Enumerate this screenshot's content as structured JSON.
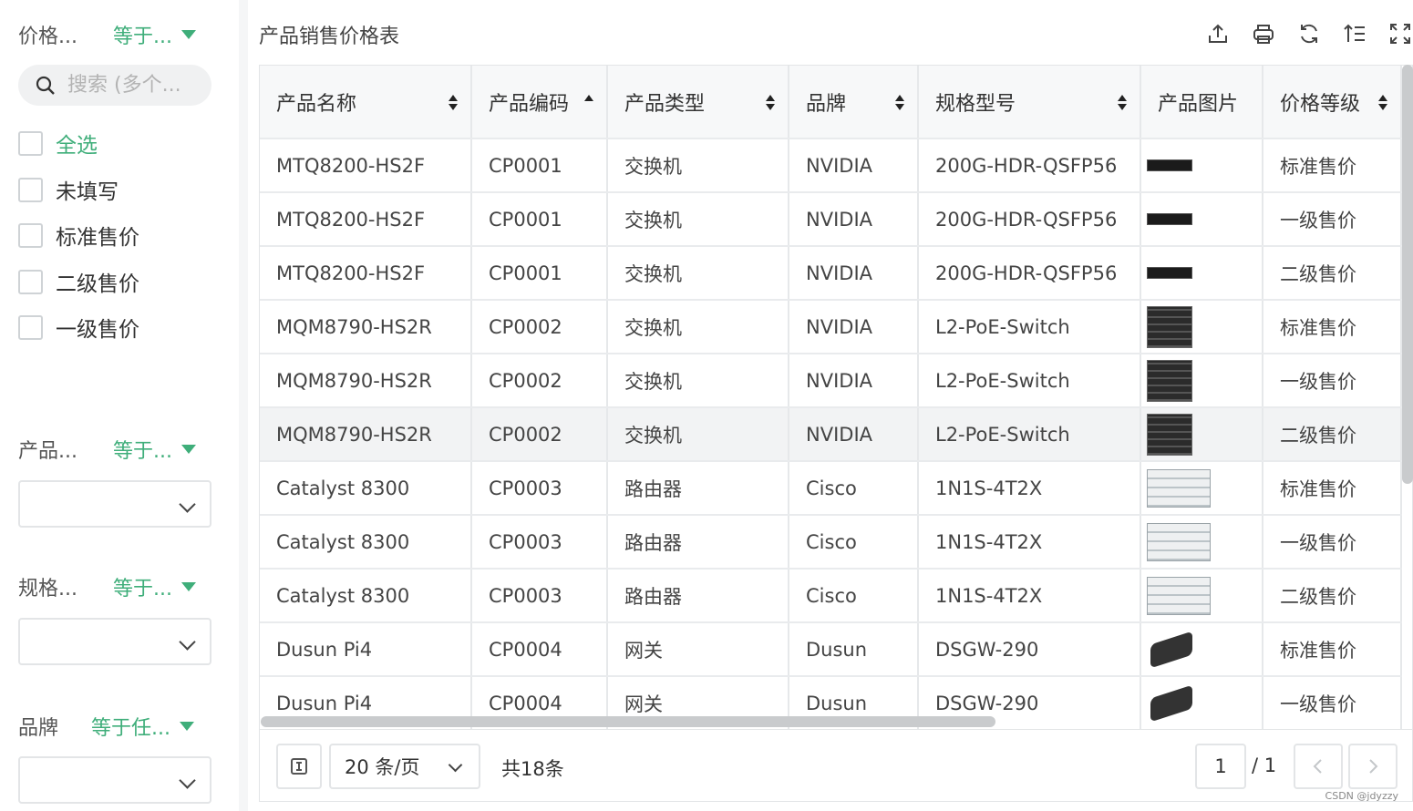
{
  "filters": {
    "price": {
      "name": "价格...",
      "op": "等于..."
    },
    "search": {
      "placeholder": "搜索 (多个..."
    },
    "options": [
      "全选",
      "未填写",
      "标准售价",
      "二级售价",
      "一级售价"
    ],
    "product": {
      "name": "产品...",
      "op": "等于..."
    },
    "spec": {
      "name": "规格...",
      "op": "等于..."
    },
    "brand": {
      "name": "品牌",
      "op": "等于任..."
    }
  },
  "title": "产品销售价格表",
  "toolbar": [
    "upload-icon",
    "print-icon",
    "refresh-icon",
    "sort-list-icon",
    "fullscreen-icon"
  ],
  "columns": [
    "产品名称",
    "产品编码",
    "产品类型",
    "品牌",
    "规格型号",
    "产品图片",
    "价格等级"
  ],
  "rows": [
    [
      "MTQ8200-HS2F",
      "CP0001",
      "交换机",
      "NVIDIA",
      "200G-HDR-QSFP56",
      "sw",
      "标准售价"
    ],
    [
      "MTQ8200-HS2F",
      "CP0001",
      "交换机",
      "NVIDIA",
      "200G-HDR-QSFP56",
      "sw",
      "一级售价"
    ],
    [
      "MTQ8200-HS2F",
      "CP0001",
      "交换机",
      "NVIDIA",
      "200G-HDR-QSFP56",
      "sw",
      "二级售价"
    ],
    [
      "MQM8790-HS2R",
      "CP0002",
      "交换机",
      "NVIDIA",
      "L2-PoE-Switch",
      "poe",
      "标准售价"
    ],
    [
      "MQM8790-HS2R",
      "CP0002",
      "交换机",
      "NVIDIA",
      "L2-PoE-Switch",
      "poe",
      "一级售价"
    ],
    [
      "MQM8790-HS2R",
      "CP0002",
      "交换机",
      "NVIDIA",
      "L2-PoE-Switch",
      "poe",
      "二级售价"
    ],
    [
      "Catalyst 8300",
      "CP0003",
      "路由器",
      "Cisco",
      "1N1S-4T2X",
      "rt",
      "标准售价"
    ],
    [
      "Catalyst 8300",
      "CP0003",
      "路由器",
      "Cisco",
      "1N1S-4T2X",
      "rt",
      "一级售价"
    ],
    [
      "Catalyst 8300",
      "CP0003",
      "路由器",
      "Cisco",
      "1N1S-4T2X",
      "rt",
      "二级售价"
    ],
    [
      "Dusun Pi4",
      "CP0004",
      "网关",
      "Dusun",
      "DSGW-290",
      "gw",
      "标准售价"
    ],
    [
      "Dusun Pi4",
      "CP0004",
      "网关",
      "Dusun",
      "DSGW-290",
      "gw",
      "一级售价"
    ]
  ],
  "pager": {
    "page_size": "20 条/页",
    "total": "共18条",
    "current": "1",
    "of_total": "/ 1"
  },
  "watermark": "CSDN @jdyzzy"
}
